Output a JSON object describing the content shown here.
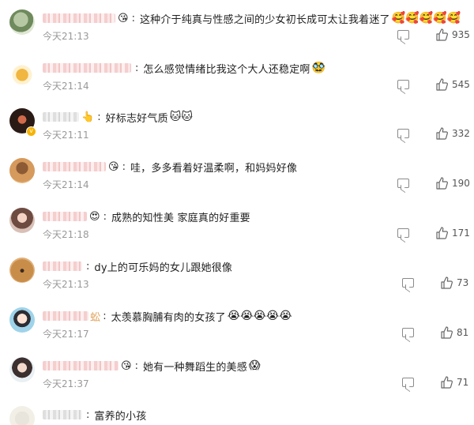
{
  "comments": [
    {
      "text": "这种介于纯真与性感之间的少女初长成可太让我着迷了",
      "emoji": "🥰🥰🥰🥰🥰",
      "badge": "😘",
      "time": "今天21:13",
      "likes": "935"
    },
    {
      "text": "怎么感觉情绪比我这个大人还稳定啊",
      "emoji": "🥸",
      "badge": "",
      "time": "今天21:14",
      "likes": "545"
    },
    {
      "text": "好标志好气质",
      "emoji": "🐱🐱",
      "badge": "👆",
      "time": "今天21:11",
      "likes": "332"
    },
    {
      "text": "哇，多多看着好温柔啊，和妈妈好像",
      "emoji": "",
      "badge": "😘",
      "time": "今天21:14",
      "likes": "190"
    },
    {
      "text": "成熟的知性美 家庭真的好重要",
      "emoji": "",
      "badge": "😍",
      "time": "今天21:18",
      "likes": "171"
    },
    {
      "text": "dy上的可乐妈的女儿跟她很像",
      "emoji": "",
      "badge": "",
      "time": "今天21:13",
      "likes": "73"
    },
    {
      "text": "太羡慕胸脯有肉的女孩了",
      "emoji": "😭😭😭😭😭",
      "badge": "",
      "name_suffix": "蚣",
      "time": "今天21:17",
      "likes": "81"
    },
    {
      "text": "她有一种舞蹈生的美感",
      "emoji": "😱",
      "badge": "😘",
      "time": "今天21:37",
      "likes": "71"
    },
    {
      "text": "富养的小孩",
      "emoji": "",
      "badge": "",
      "time": "",
      "likes": ""
    }
  ],
  "icons": {
    "reply": "comment-icon",
    "like": "thumbs-up-icon",
    "verified": "verified-badge-icon"
  },
  "colors": {
    "time": "#999999",
    "verified": "#f6b300"
  }
}
